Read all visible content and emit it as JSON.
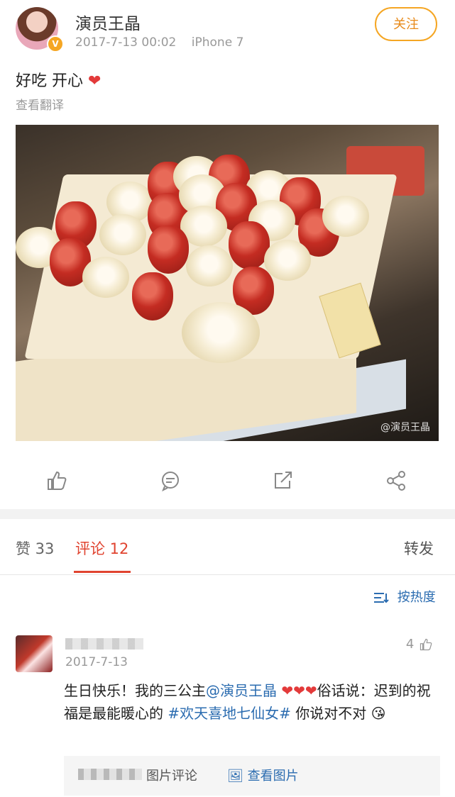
{
  "post": {
    "author": "演员王晶",
    "verified_badge": "V",
    "time": "2017-7-13 00:02",
    "device": "iPhone 7",
    "follow_label": "关注",
    "text": "好吃 开心",
    "translate_label": "查看翻译",
    "watermark": "@演员王晶"
  },
  "actions": {
    "icons": [
      "like-icon",
      "comment-icon",
      "share-icon",
      "more-share-icon"
    ]
  },
  "tabs": {
    "likes": "赞 33",
    "comments": "评论 12",
    "reposts": "转发"
  },
  "sort": {
    "label": "按热度"
  },
  "comment": {
    "date": "2017-7-13",
    "likes": "4",
    "text_1": "生日快乐！我的三公主",
    "mention": "@演员王晶",
    "text_2": "俗话说：迟到的祝福是最能暖心的",
    "topic": "#欢天喜地七仙女#",
    "text_3": " 你说对不对",
    "image_label": "图片评论",
    "view_image": "查看图片"
  },
  "colors": {
    "accent": "#e0432f",
    "link": "#2b6cb0",
    "follow": "#f5a623"
  }
}
